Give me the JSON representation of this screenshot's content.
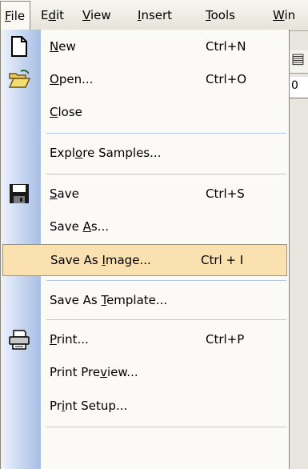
{
  "menubar": {
    "items": [
      {
        "pre": "",
        "u": "F",
        "post": "ile"
      },
      {
        "pre": "E",
        "u": "d",
        "post": "it"
      },
      {
        "pre": "",
        "u": "V",
        "post": "iew"
      },
      {
        "pre": "",
        "u": "I",
        "post": "nsert"
      },
      {
        "pre": "",
        "u": "T",
        "post": "ools"
      },
      {
        "pre": "",
        "u": "W",
        "post": "in"
      }
    ]
  },
  "background": {
    "field_text": "0"
  },
  "menu": {
    "items": [
      {
        "pre": "",
        "u": "N",
        "post": "ew",
        "shortcut": "Ctrl+N",
        "icon": "new-document-icon"
      },
      {
        "pre": "",
        "u": "O",
        "post": "pen...",
        "shortcut": "Ctrl+O",
        "icon": "open-folder-icon"
      },
      {
        "pre": "",
        "u": "C",
        "post": "lose",
        "shortcut": "",
        "icon": ""
      },
      {
        "pre": "Expl",
        "u": "o",
        "post": "re Samples...",
        "shortcut": "",
        "icon": ""
      },
      {
        "pre": "",
        "u": "S",
        "post": "ave",
        "shortcut": "Ctrl+S",
        "icon": "save-disk-icon"
      },
      {
        "pre": "Save ",
        "u": "A",
        "post": "s...",
        "shortcut": "",
        "icon": ""
      },
      {
        "pre": "Save As ",
        "u": "I",
        "post": "mage...",
        "shortcut": "Ctrl + I",
        "icon": "",
        "highlighted": true
      },
      {
        "pre": "Save As ",
        "u": "T",
        "post": "emplate...",
        "shortcut": "",
        "icon": ""
      },
      {
        "pre": "",
        "u": "P",
        "post": "rint...",
        "shortcut": "Ctrl+P",
        "icon": "printer-icon"
      },
      {
        "pre": "Print Pre",
        "u": "v",
        "post": "iew...",
        "shortcut": "",
        "icon": ""
      },
      {
        "pre": "Pr",
        "u": "i",
        "post": "nt Setup...",
        "shortcut": "",
        "icon": ""
      }
    ],
    "colors": {
      "highlight": "#fbe0b0",
      "gutter": "#c2d2ee"
    }
  }
}
